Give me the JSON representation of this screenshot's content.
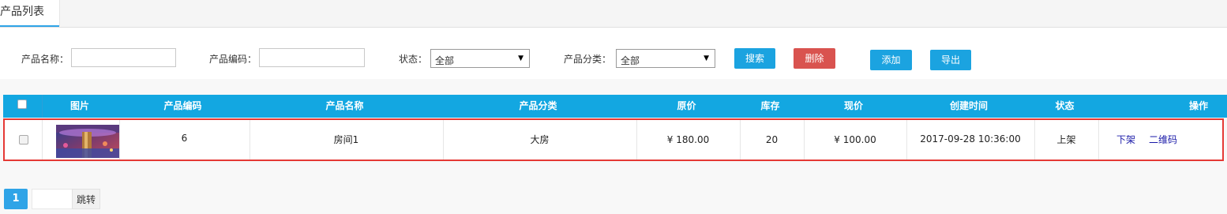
{
  "tab": {
    "label": "产品列表"
  },
  "filter": {
    "name_label": "产品名称：",
    "name_value": "",
    "code_label": "产品编码：",
    "code_value": "",
    "status_label": "状态：",
    "status_selected": "全部",
    "category_label": "产品分类：",
    "category_selected": "全部",
    "search_button": "搜索",
    "delete_button": "删除",
    "add_button": "添加",
    "export_button": "导出"
  },
  "table": {
    "headers": [
      "图片",
      "产品编码",
      "产品名称",
      "产品分类",
      "原价",
      "库存",
      "现价",
      "创建时间",
      "状态",
      "操作"
    ],
    "rows": [
      {
        "code": "6",
        "name": "房间1",
        "category": "大房",
        "original_price": "¥ 180.00",
        "stock": "20",
        "current_price": "¥ 100.00",
        "created": "2017-09-28 10:36:00",
        "status": "上架",
        "action_1": "下架",
        "action_2": "二维码"
      }
    ]
  },
  "pager": {
    "current_page": "1",
    "jump_input": "",
    "jump_button": "跳转"
  },
  "colors": {
    "header_blue": "#13a7e1",
    "button_blue": "#1ba3e0",
    "button_red": "#d9534f",
    "highlight_red": "#e53935",
    "link_blue": "#1a1aa8"
  }
}
